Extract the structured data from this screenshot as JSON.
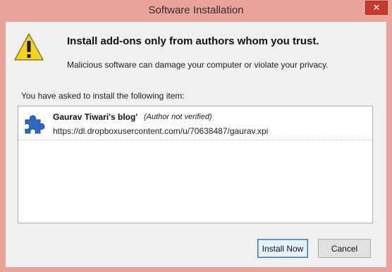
{
  "window": {
    "title": "Software Installation",
    "close_glyph": "✕"
  },
  "warning": {
    "icon": "warning-triangle-icon",
    "headline": "Install add-ons only from authors whom you trust.",
    "subtext": "Malicious software can damage your computer or violate your privacy."
  },
  "list": {
    "caption": "You have asked to install the following item:",
    "items": [
      {
        "icon": "puzzle-piece-icon",
        "name": "Gaurav Tiwari's blog'",
        "status": "(Author not verified)",
        "url": "https://dl.dropboxusercontent.com/u/70638487/gaurav.xpi"
      }
    ]
  },
  "buttons": {
    "install_label": "Install Now",
    "cancel_label": "Cancel"
  },
  "colors": {
    "titlebar": "#e8a39b",
    "close_button": "#c7392b",
    "warning_yellow": "#f6d41b",
    "puzzle_blue": "#2d68c4"
  }
}
